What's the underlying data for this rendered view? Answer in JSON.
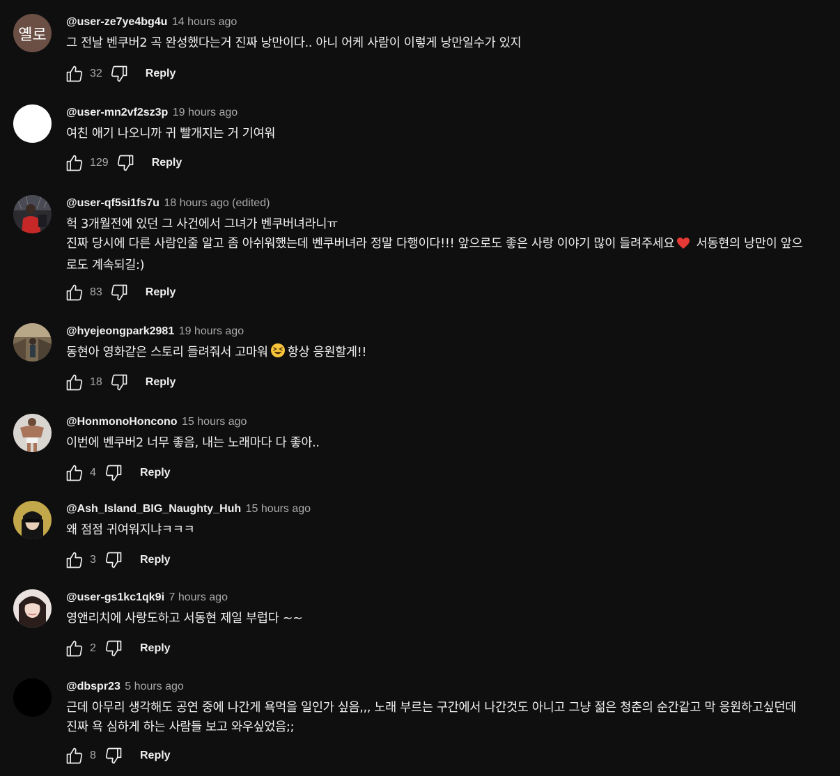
{
  "comments": [
    {
      "author": "@user-ze7ye4bg4u",
      "time": "14 hours ago",
      "avatar_text": "옐로",
      "text": "그 전날 벤쿠버2 곡 완성했다는거 진짜 낭만이다.. 아니 어케 사람이 이렇게 낭만일수가 있지",
      "likes": "32",
      "reply_label": "Reply"
    },
    {
      "author": "@user-mn2vf2sz3p",
      "time": "19 hours ago",
      "text": "여친 애기 나오니까 귀 빨개지는 거 기여워",
      "likes": "129",
      "reply_label": "Reply"
    },
    {
      "author": "@user-qf5si1fs7u",
      "time": "18 hours ago (edited)",
      "text_line1": "헉 3개월전에 있던 그 사건에서 그녀가 벤쿠버녀라니ㅠ",
      "text_line2a": "진짜 당시에 다른 사람인줄 알고 좀 아쉬워했는데 벤쿠버녀라 정말 다행이다!!! 앞으로도 좋은 사랑 이야기 많이 들려주세요",
      "text_line2b": " 서동현의 낭만이 앞으",
      "text_line3": "로도 계속되길:)",
      "likes": "83",
      "reply_label": "Reply"
    },
    {
      "author": "@hyejeongpark2981",
      "time": "19 hours ago",
      "text_a": "동현아 영화같은 스토리 들려줘서 고마워",
      "text_b": "항상 응원할게!!",
      "likes": "18",
      "reply_label": "Reply"
    },
    {
      "author": "@HonmonoHoncono",
      "time": "15 hours ago",
      "text": "이번에 벤쿠버2 너무 좋음, 내는 노래마다 다 좋아..",
      "likes": "4",
      "reply_label": "Reply"
    },
    {
      "author": "@Ash_Island_BIG_Naughty_Huh",
      "time": "15 hours ago",
      "text": "왜 점점 귀여워지냐ㅋㅋㅋ",
      "likes": "3",
      "reply_label": "Reply"
    },
    {
      "author": "@user-gs1kc1qk9i",
      "time": "7 hours ago",
      "text": "영앤리치에 사랑도하고 서동현 제일 부럽다 ~~",
      "likes": "2",
      "reply_label": "Reply"
    },
    {
      "author": "@dbspr23",
      "time": "5 hours ago",
      "text_line1": "근데 아무리 생각해도 공연 중에 나간게 욕먹을 일인가 싶음,,, 노래 부르는 구간에서 나간것도 아니고 그냥 젊은 청춘의 순간같고 막 응원하고싶던데",
      "text_line2": "진짜 욕 심하게 하는 사람들 보고 와우싶었음;;",
      "likes": "8",
      "reply_label": "Reply"
    }
  ],
  "icons": {
    "like": "thumbs-up-icon",
    "dislike": "thumbs-down-icon",
    "heart_emoji": "heart-emoji-icon",
    "grin_emoji": "grinning-squint-emoji-icon"
  },
  "colors": {
    "background": "#0f0f0f",
    "text_primary": "#f1f1f1",
    "text_secondary": "#aaaaaa",
    "heart": "#e53935",
    "emoji_yellow": "#f7c53a"
  }
}
